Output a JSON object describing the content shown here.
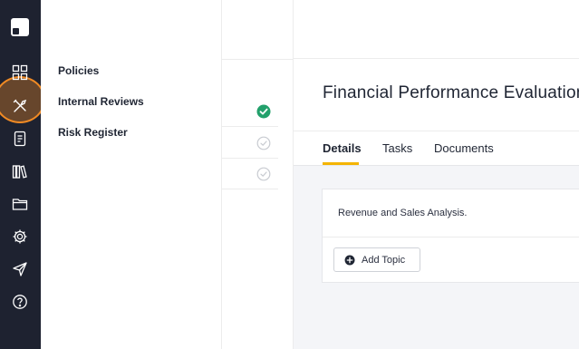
{
  "submenu": {
    "items": [
      {
        "label": "Policies"
      },
      {
        "label": "Internal Reviews"
      },
      {
        "label": "Risk Register"
      }
    ]
  },
  "main": {
    "title": "Financial Performance Evaluation",
    "tabs": [
      {
        "label": "Details",
        "active": true
      },
      {
        "label": "Tasks",
        "active": false
      },
      {
        "label": "Documents",
        "active": false
      }
    ],
    "topic_description": "Revenue and Sales Analysis.",
    "add_topic_label": "Add Topic"
  },
  "checklist": [
    {
      "status": "complete"
    },
    {
      "status": "pending"
    },
    {
      "status": "pending"
    }
  ],
  "colors": {
    "rail_bg": "#1e2230",
    "accent": "#f4b400",
    "highlight": "#f08a24",
    "success": "#22a06b"
  },
  "icons": {
    "rail": [
      "app-logo-icon",
      "dashboard-icon",
      "tools-icon",
      "document-icon",
      "library-icon",
      "folder-icon",
      "settings-icon",
      "rocket-icon",
      "help-icon"
    ]
  }
}
